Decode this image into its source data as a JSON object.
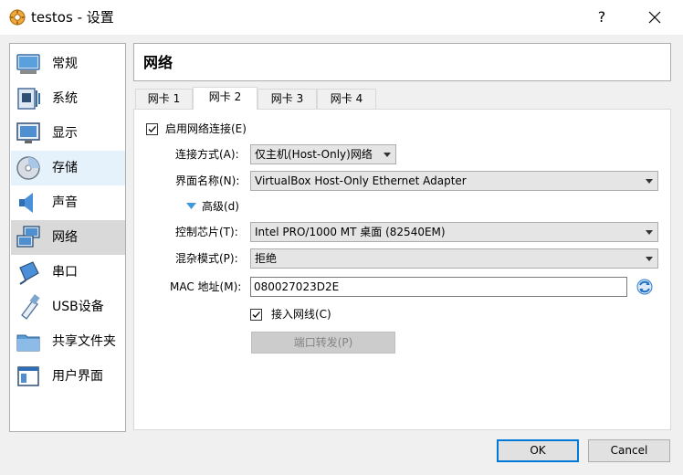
{
  "window": {
    "title": "testos - 设置",
    "help": "?",
    "close": "✕"
  },
  "sidebar": {
    "items": [
      {
        "label": "常规",
        "icon": "monitor-icon"
      },
      {
        "label": "系统",
        "icon": "chip-icon"
      },
      {
        "label": "显示",
        "icon": "display-icon"
      },
      {
        "label": "存储",
        "icon": "disk-icon"
      },
      {
        "label": "声音",
        "icon": "speaker-icon"
      },
      {
        "label": "网络",
        "icon": "network-icon"
      },
      {
        "label": "串口",
        "icon": "serial-port-icon"
      },
      {
        "label": "USB设备",
        "icon": "usb-icon"
      },
      {
        "label": "共享文件夹",
        "icon": "folder-icon"
      },
      {
        "label": "用户界面",
        "icon": "window-icon"
      }
    ],
    "selected": "网络",
    "hovered": "存储"
  },
  "page": {
    "title": "网络"
  },
  "tabs": [
    "网卡 1",
    "网卡 2",
    "网卡 3",
    "网卡 4"
  ],
  "active_tab": "网卡 2",
  "form": {
    "enable_label": "启用网络连接(E)",
    "enable_checked": true,
    "attached_label": "连接方式(A):",
    "attached_value": "仅主机(Host-Only)网络",
    "name_label": "界面名称(N):",
    "name_value": "VirtualBox Host-Only Ethernet Adapter",
    "advanced_label": "高级(d)",
    "adapter_label": "控制芯片(T):",
    "adapter_value": "Intel PRO/1000 MT 桌面 (82540EM)",
    "promisc_label": "混杂模式(P):",
    "promisc_value": "拒绝",
    "mac_label": "MAC 地址(M):",
    "mac_value": "080027023D2E",
    "cable_label": "接入网线(C)",
    "cable_checked": true,
    "port_forward_label": "端口转发(P)"
  },
  "buttons": {
    "ok": "OK",
    "cancel": "Cancel"
  },
  "colors": {
    "accent": "#0078d7",
    "selected_bg": "#d9d9d9",
    "hover_bg": "#e5f1fb"
  }
}
